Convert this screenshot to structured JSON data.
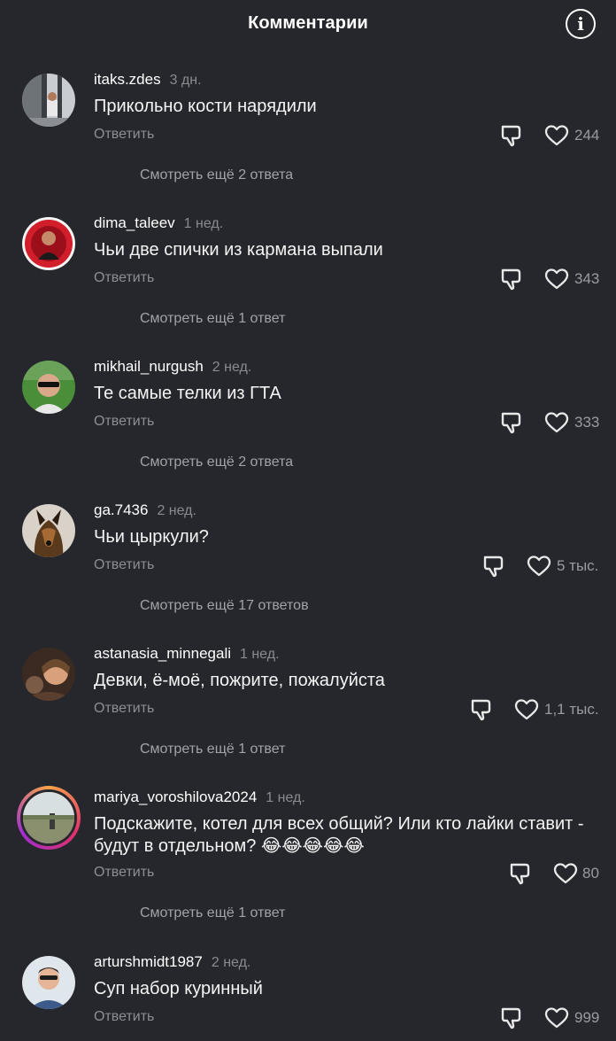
{
  "header": {
    "title": "Комментарии",
    "info_icon": "info-icon"
  },
  "ui": {
    "reply_label": "Ответить"
  },
  "comments": [
    {
      "user": "itaks.zdes",
      "time": "3 дн.",
      "text": "Прикольно кости нарядили",
      "likes": "244",
      "more": "Смотреть ещё 2 ответа"
    },
    {
      "user": "dima_taleev",
      "time": "1 нед.",
      "text": "Чьи две спички из кармана выпали",
      "likes": "343",
      "more": "Смотреть ещё 1 ответ"
    },
    {
      "user": "mikhail_nurgush",
      "time": "2 нед.",
      "text": "Те самые телки из ГТА",
      "likes": "333",
      "more": "Смотреть ещё 2 ответа"
    },
    {
      "user": "ga.7436",
      "time": "2 нед.",
      "text": "Чьи цыркули?",
      "likes": "5 тыс.",
      "more": "Смотреть ещё 17 ответов"
    },
    {
      "user": "astanasia_minnegali",
      "time": "1 нед.",
      "text": "Девки, ё-моё, пожрите, пожалуйста",
      "likes": "1,1 тыс.",
      "more": "Смотреть ещё 1 ответ"
    },
    {
      "user": "mariya_voroshilova2024",
      "time": "1 нед.",
      "text": "Подскажите, котел для всех общий? Или кто лайки ставит - будут в отдельном? 😂😂😂😂😂",
      "likes": "80",
      "more": "Смотреть ещё 1 ответ"
    },
    {
      "user": "arturshmidt1987",
      "time": "2 нед.",
      "text": "Суп набор куринный",
      "likes": "999",
      "more": ""
    }
  ],
  "colors": {
    "background": "#26272c",
    "muted": "#8d8e93",
    "story_ring": "#e1306c"
  }
}
